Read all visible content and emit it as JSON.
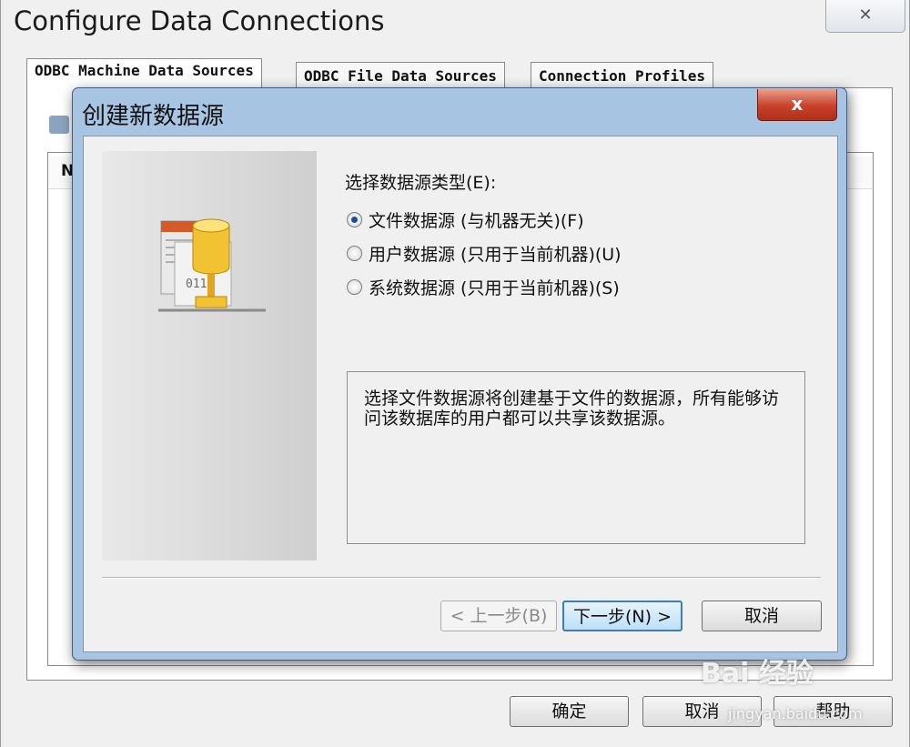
{
  "window": {
    "title": "Configure Data Connections",
    "close_glyph": "✕"
  },
  "tabs": [
    {
      "label": "ODBC Machine Data Sources",
      "active": true
    },
    {
      "label": "ODBC File Data Sources",
      "active": false
    },
    {
      "label": "Connection Profiles",
      "active": false
    }
  ],
  "panel": {
    "list_header": "N"
  },
  "footer": {
    "ok_label": "确定",
    "cancel_label": "取消",
    "help_label": "帮助"
  },
  "dialog": {
    "title": "创建新数据源",
    "close_glyph": "x",
    "prompt": "选择数据源类型(E):",
    "options": [
      {
        "label": "文件数据源 (与机器无关)(F)",
        "checked": true
      },
      {
        "label": "用户数据源 (只用于当前机器)(U)",
        "checked": false
      },
      {
        "label": "系统数据源 (只用于当前机器)(S)",
        "checked": false
      }
    ],
    "description": "选择文件数据源将创建基于文件的数据源，所有能够访问该数据库的用户都可以共享该数据源。",
    "back_label": "< 上一步(B)",
    "next_label": "下一步(N) >",
    "cancel_label": "取消"
  },
  "watermark": {
    "brand": "Bai 经验",
    "url": "jingyan.baidu.com"
  },
  "icons": {
    "database_illustration": "database-cylinder-icon",
    "binary_text": "0110"
  }
}
